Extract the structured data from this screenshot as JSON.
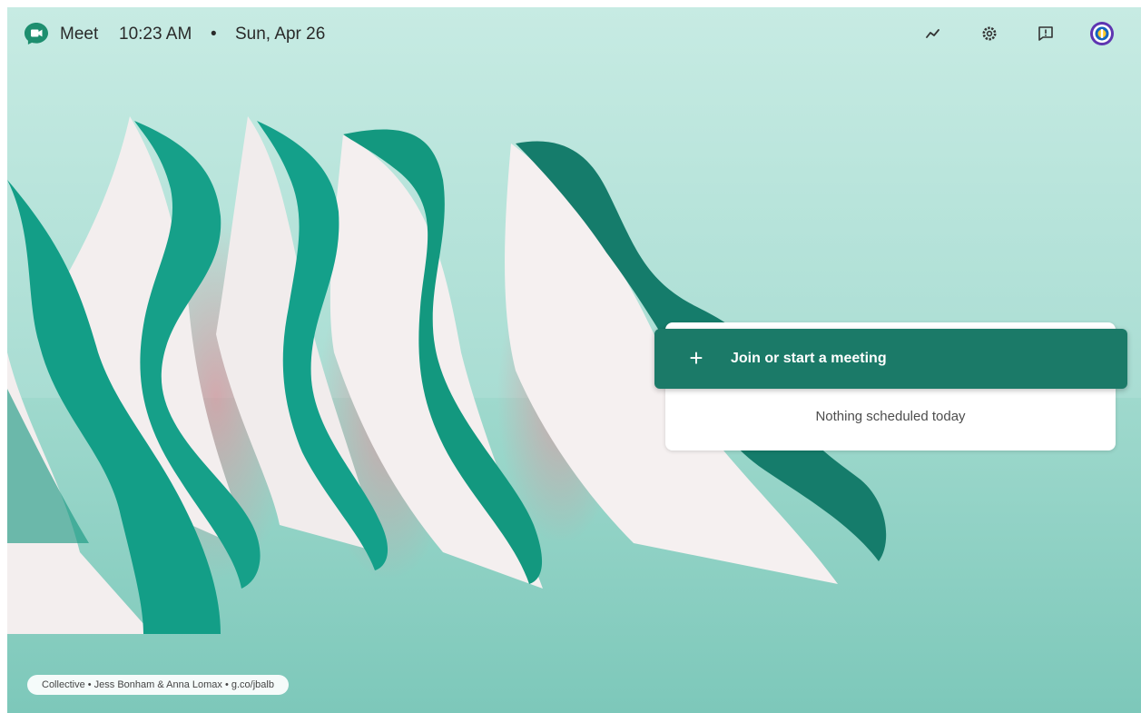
{
  "app": {
    "name": "Meet",
    "time": "10:23 AM",
    "separator": "•",
    "date": "Sun, Apr 26"
  },
  "toolbar": {
    "icons": [
      "activity-icon",
      "settings-gear-icon",
      "feedback-icon",
      "account-avatar"
    ]
  },
  "meeting": {
    "join_plus": "+",
    "join_label": "Join or start a meeting",
    "empty_label": "Nothing scheduled today"
  },
  "credit": {
    "collection": "Collective",
    "sep": " • ",
    "artists": "Jess Bonham & Anna Lomax",
    "link": "g.co/jbalb"
  },
  "colors": {
    "accent": "#1b7a68",
    "teal_shape": "#139e87",
    "background": "#b4e3da"
  }
}
